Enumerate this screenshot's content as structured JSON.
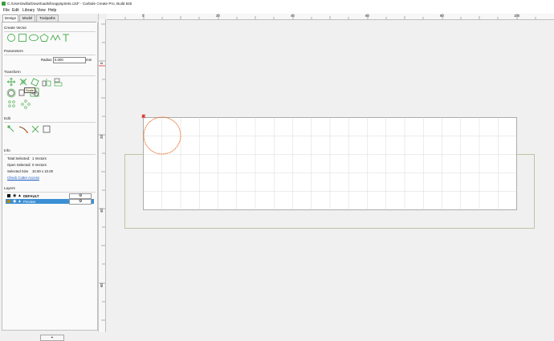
{
  "window": {
    "title": "C:/Users/willa/Downloads/knappspirets.c2d* - Carbide Create Pro, Build 845"
  },
  "menu": [
    "File",
    "Edit",
    "Library",
    "View",
    "Help"
  ],
  "tabs": [
    "Design",
    "Model",
    "Toolpaths"
  ],
  "sections": {
    "create_vector": "Create Vector",
    "parameters": "Parameters",
    "transform": "Transform",
    "edit": "Edit",
    "info": "Info",
    "layers": "Layers"
  },
  "parameters": {
    "radius_label": "Radius",
    "radius_value": "5.000",
    "radius_unit": "mm"
  },
  "tooltip": "Scale",
  "info": {
    "total_selected_label": "Total Selected:",
    "total_selected_value": "1 Vectors",
    "open_selected_label": "Open Selected:",
    "open_selected_value": "0 Vectors",
    "selected_size_label": "Selected Size",
    "selected_size_value": "10.00 x 10.00",
    "check_link": "Check Cutter Access"
  },
  "layers": [
    {
      "name": "DEFAULT",
      "swatch": "#000000",
      "selected": false
    },
    {
      "name": "Preview",
      "swatch": "#b8860b",
      "selected": true
    }
  ],
  "add_layer_button": "+",
  "ruler": {
    "x_labels": [
      "0",
      "20",
      "40",
      "60",
      "80",
      "100"
    ],
    "y_labels": [
      "0",
      "20",
      "40",
      "60"
    ]
  },
  "colors": {
    "accent_green": "#4caf50",
    "selection_orange": "#e8661c",
    "layer_selected": "#3b8fd4",
    "stock_border": "#b8b891",
    "grid_line": "#d8d8d8"
  }
}
